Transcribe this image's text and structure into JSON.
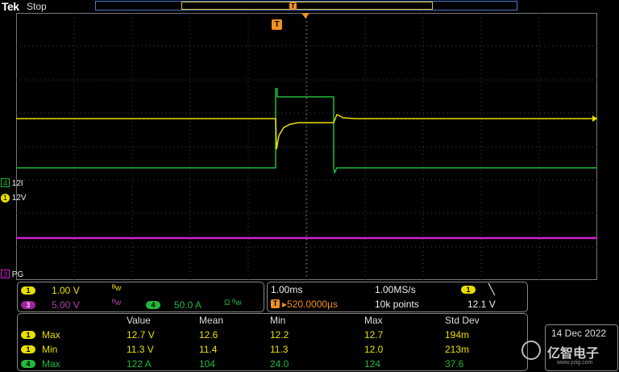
{
  "header": {
    "brand": "Tek",
    "acq_state": "Stop"
  },
  "markers": {
    "trigger_letter": "T"
  },
  "channels": [
    {
      "num": "4",
      "label": "12I",
      "color": "#22b83a"
    },
    {
      "num": "1",
      "label": "12V",
      "color": "#e8e000"
    },
    {
      "num": "3",
      "label": "PG",
      "color": "#d020d0"
    }
  ],
  "scales": {
    "ch1": {
      "num": "1",
      "value": "1.00 V",
      "suffix": "ᴮw"
    },
    "ch3": {
      "num": "3",
      "value": "5.00 V",
      "suffix": "ᴮw"
    },
    "ch4": {
      "num": "4",
      "value": "50.0 A",
      "suffix": "Ω ᴮw"
    }
  },
  "timebase": {
    "scale": "1.00ms",
    "sample_rate": "1.00MS/s",
    "trigger_channel": "1",
    "trigger_slope": "╲",
    "position": "▸520.0000µs",
    "record_length": "10k points",
    "trigger_level": "12.1 V"
  },
  "measurements": {
    "headers": [
      "Value",
      "Mean",
      "Min",
      "Max",
      "Std Dev"
    ],
    "rows": [
      {
        "ch": "1",
        "type": "Max",
        "values": [
          "12.7 V",
          "12.6",
          "12.2",
          "12.7",
          "194m"
        ]
      },
      {
        "ch": "1",
        "type": "Min",
        "values": [
          "11.3 V",
          "11.4",
          "11.3",
          "12.0",
          "213m"
        ]
      },
      {
        "ch": "4",
        "type": "Max",
        "values": [
          "122 A",
          "104",
          "24.0",
          "124",
          "37.6"
        ]
      }
    ]
  },
  "status": {
    "date": "14 Dec 2022"
  },
  "watermark": {
    "text": "亿智电子",
    "url": "www.yzig.com"
  }
}
